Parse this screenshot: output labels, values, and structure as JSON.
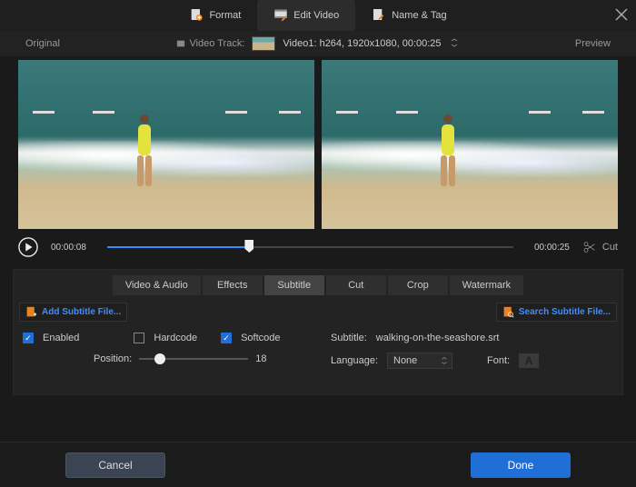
{
  "topTabs": {
    "format": "Format",
    "edit": "Edit Video",
    "name": "Name & Tag"
  },
  "labels": {
    "original": "Original",
    "preview": "Preview",
    "videoTrack": "Video Track:"
  },
  "track": {
    "info": "Video1: h264, 1920x1080, 00:00:25"
  },
  "player": {
    "current": "00:00:08",
    "total": "00:00:25",
    "cut": "Cut"
  },
  "subtabs": {
    "va": "Video & Audio",
    "effects": "Effects",
    "subtitle": "Subtitle",
    "cut": "Cut",
    "crop": "Crop",
    "watermark": "Watermark"
  },
  "subtitleBtns": {
    "add": "Add Subtitle File...",
    "search": "Search Subtitle File..."
  },
  "form": {
    "enabled": "Enabled",
    "hardcode": "Hardcode",
    "softcode": "Softcode",
    "positionLabel": "Position:",
    "positionVal": "18",
    "subtitleLabel": "Subtitle:",
    "subtitleFile": "walking-on-the-seashore.srt",
    "languageLabel": "Language:",
    "languageVal": "None",
    "fontLabel": "Font:",
    "fontGlyph": "A"
  },
  "footer": {
    "cancel": "Cancel",
    "done": "Done"
  }
}
